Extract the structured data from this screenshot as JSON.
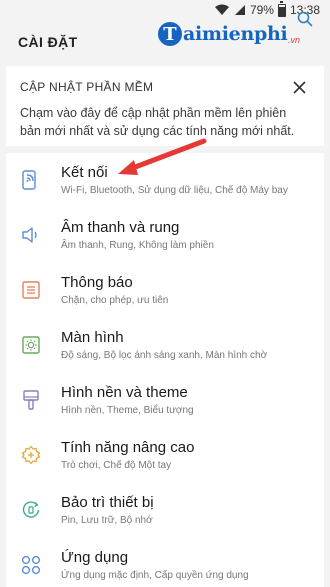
{
  "status_bar": {
    "battery_percent": "79%",
    "time": "13:38",
    "battery_level": 0.79
  },
  "header": {
    "title": "CÀI ĐẶT",
    "logo_letter": "T",
    "logo_text": "aimienphi",
    "logo_suffix": ".vn",
    "search_icon": "search-icon"
  },
  "update_card": {
    "title": "CẬP NHẬT PHẦN MỀM",
    "description": "Chạm vào đây để cập nhật phần mềm lên phiên bản mới nhất và sử dụng các tính năng mới nhất.",
    "close_icon": "close-icon"
  },
  "settings": [
    {
      "label": "Kết nối",
      "sub": "Wi-Fi, Bluetooth, Sử dụng dữ liệu, Chế độ Máy bay",
      "icon": "connections-icon"
    },
    {
      "label": "Âm thanh và rung",
      "sub": "Âm thanh, Rung, Không làm phiền",
      "icon": "speaker-icon"
    },
    {
      "label": "Thông báo",
      "sub": "Chặn, cho phép, ưu tiên",
      "icon": "notifications-icon"
    },
    {
      "label": "Màn hình",
      "sub": "Độ sáng, Bộ lọc ánh sáng xanh, Màn hình chờ",
      "icon": "display-icon"
    },
    {
      "label": "Hình nền và theme",
      "sub": "Hình nền, Theme, Biểu tượng",
      "icon": "paintbrush-icon"
    },
    {
      "label": "Tính năng nâng cao",
      "sub": "Trò chơi, Chế độ Một tay",
      "icon": "gear-plus-icon"
    },
    {
      "label": "Bảo trì thiết bị",
      "sub": "Pin, Lưu trữ, Bộ nhớ",
      "icon": "device-care-icon"
    },
    {
      "label": "Ứng dụng",
      "sub": "Ứng dụng mặc định, Cấp quyền ứng dụng",
      "icon": "apps-icon"
    }
  ],
  "colors": {
    "icon_blue": "#5c8fd6",
    "icon_orange": "#e8805c",
    "icon_green": "#6aaa5e",
    "icon_purple": "#8e7cc3",
    "icon_yellow": "#e5a93a",
    "icon_teal": "#3aa88f",
    "arrow_red": "#e53935",
    "logo_blue": "#1565c0"
  }
}
